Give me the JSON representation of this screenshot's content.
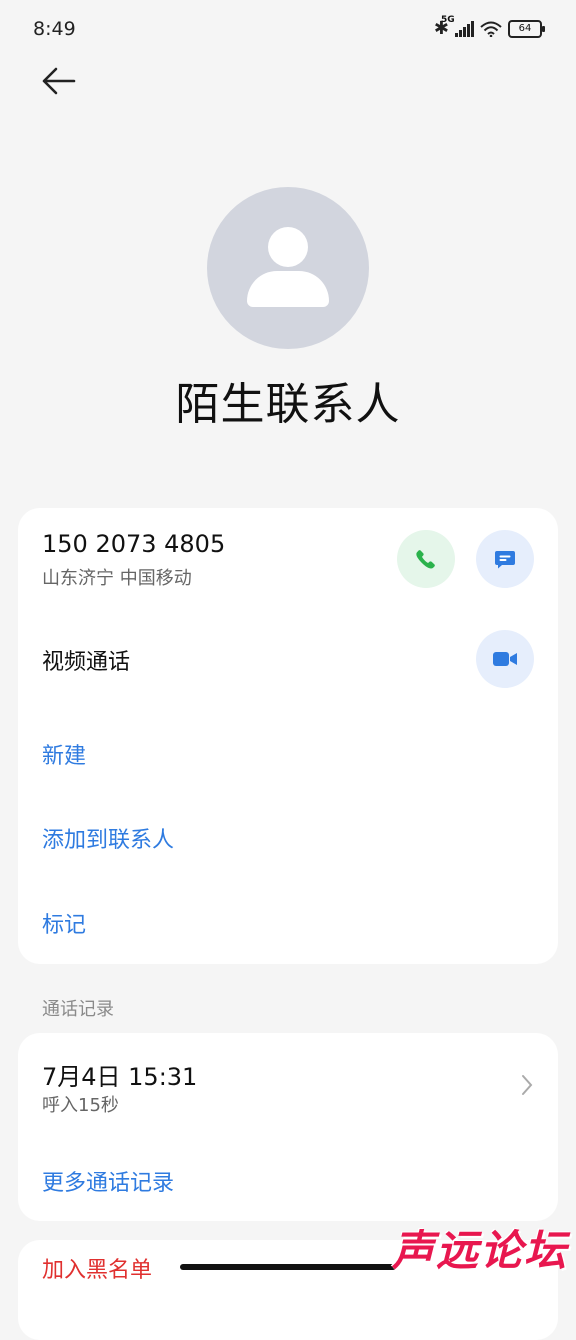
{
  "status_bar": {
    "time": "8:49",
    "network": "5G",
    "battery": "64"
  },
  "contact": {
    "name": "陌生联系人",
    "phone": "150 2073 4805",
    "location": "山东济宁 中国移动"
  },
  "actions": {
    "video_call": "视频通话",
    "new": "新建",
    "add_to_contacts": "添加到联系人",
    "mark": "标记"
  },
  "call_log": {
    "section_title": "通话记录",
    "entries": [
      {
        "datetime": "7月4日 15:31",
        "detail": "呼入15秒"
      }
    ],
    "more": "更多通话记录"
  },
  "blacklist": "加入黑名单",
  "watermark": "声远论坛",
  "colors": {
    "accent_blue": "#2f7be0",
    "call_green": "#2bb24c",
    "danger_red": "#e0302f"
  }
}
